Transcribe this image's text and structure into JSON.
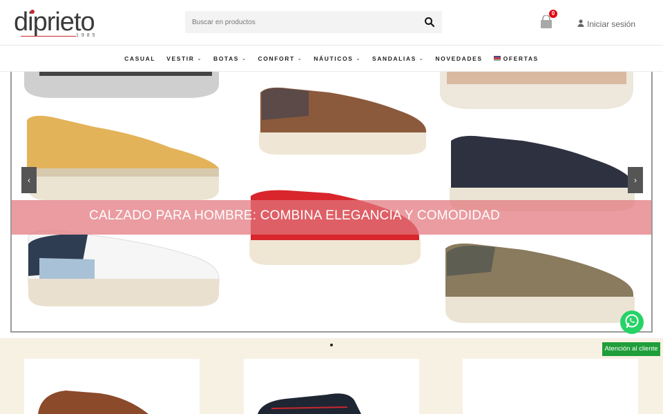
{
  "header": {
    "logo_text": "diprieto",
    "logo_year": "1985",
    "search_placeholder": "Buscar en productos",
    "cart_count": "0",
    "login_label": "Iniciar sesión"
  },
  "nav": {
    "items": [
      {
        "label": "CASUAL",
        "has_dropdown": false
      },
      {
        "label": "VESTIR",
        "has_dropdown": true
      },
      {
        "label": "BOTAS",
        "has_dropdown": true
      },
      {
        "label": "CONFORT",
        "has_dropdown": true
      },
      {
        "label": "NÁUTICOS",
        "has_dropdown": true
      },
      {
        "label": "SANDALIAS",
        "has_dropdown": true
      },
      {
        "label": "NOVEDADES",
        "has_dropdown": false
      },
      {
        "label": "OFERTAS",
        "has_dropdown": false
      }
    ]
  },
  "hero": {
    "banner_text": "CALZADO PARA HOMBRE: COMBINA ELEGANCIA Y COMODIDAD",
    "prev_label": "‹",
    "next_label": "›"
  },
  "support": {
    "label": "Atención al cliente"
  },
  "colors": {
    "accent_red": "#c9272d",
    "badge_red": "#e30613",
    "banner_pink": "#e2767d",
    "whatsapp_green": "#25d366",
    "support_green": "#1f9e3a",
    "bottom_bg": "#f7f1e3"
  }
}
